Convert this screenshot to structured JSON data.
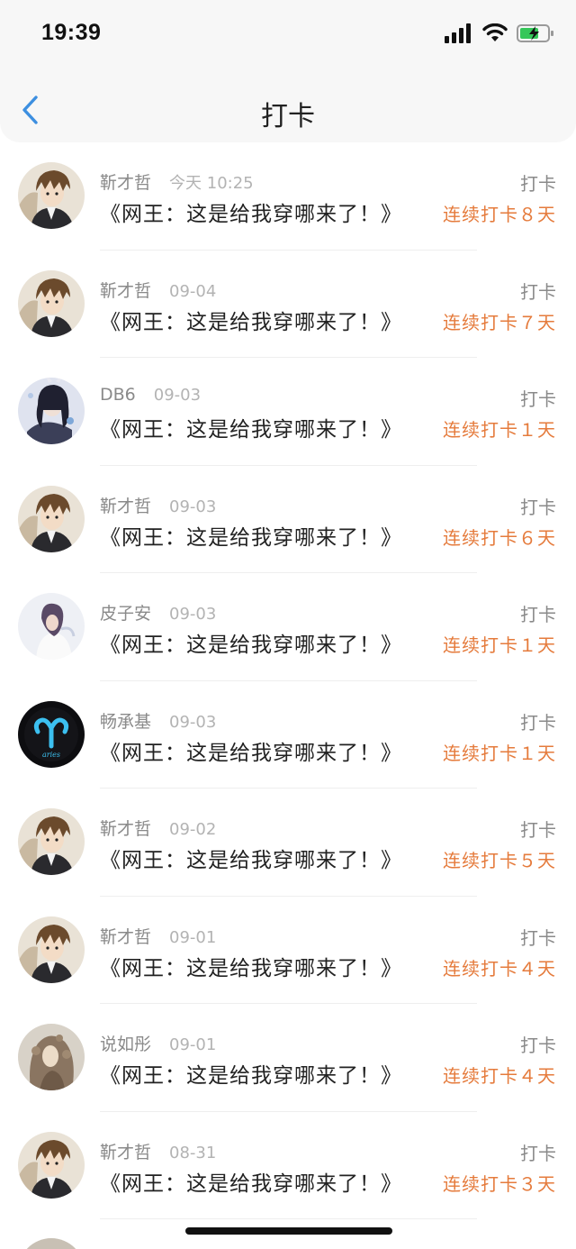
{
  "status_bar": {
    "time": "19:39"
  },
  "nav": {
    "title": "打卡"
  },
  "items": [
    {
      "name": "靳才哲",
      "date": "今天 10:25",
      "book": "《网王：这是给我穿哪来了！》",
      "tag": "打卡",
      "streak": "连续打卡８天",
      "avatar": "anime-boy"
    },
    {
      "name": "靳才哲",
      "date": "09-04",
      "book": "《网王：这是给我穿哪来了！》",
      "tag": "打卡",
      "streak": "连续打卡７天",
      "avatar": "anime-boy"
    },
    {
      "name": "DB6",
      "date": "09-03",
      "book": "《网王：这是给我穿哪来了！》",
      "tag": "打卡",
      "streak": "连续打卡１天",
      "avatar": "anime-girl-dark"
    },
    {
      "name": "靳才哲",
      "date": "09-03",
      "book": "《网王：这是给我穿哪来了！》",
      "tag": "打卡",
      "streak": "连续打卡６天",
      "avatar": "anime-boy"
    },
    {
      "name": "皮子安",
      "date": "09-03",
      "book": "《网王：这是给我穿哪来了！》",
      "tag": "打卡",
      "streak": "连续打卡１天",
      "avatar": "girl-white"
    },
    {
      "name": "畅承基",
      "date": "09-03",
      "book": "《网王：这是给我穿哪来了！》",
      "tag": "打卡",
      "streak": "连续打卡１天",
      "avatar": "aries"
    },
    {
      "name": "靳才哲",
      "date": "09-02",
      "book": "《网王：这是给我穿哪来了！》",
      "tag": "打卡",
      "streak": "连续打卡５天",
      "avatar": "anime-boy"
    },
    {
      "name": "靳才哲",
      "date": "09-01",
      "book": "《网王：这是给我穿哪来了！》",
      "tag": "打卡",
      "streak": "连续打卡４天",
      "avatar": "anime-boy"
    },
    {
      "name": "说如彤",
      "date": "09-01",
      "book": "《网王：这是给我穿哪来了！》",
      "tag": "打卡",
      "streak": "连续打卡４天",
      "avatar": "girl-curly"
    },
    {
      "name": "靳才哲",
      "date": "08-31",
      "book": "《网王：这是给我穿哪来了！》",
      "tag": "打卡",
      "streak": "连续打卡３天",
      "avatar": "anime-boy"
    }
  ],
  "colors": {
    "accent": "#e57b3c",
    "back_arrow": "#3d8fe0",
    "battery": "#35c759"
  }
}
